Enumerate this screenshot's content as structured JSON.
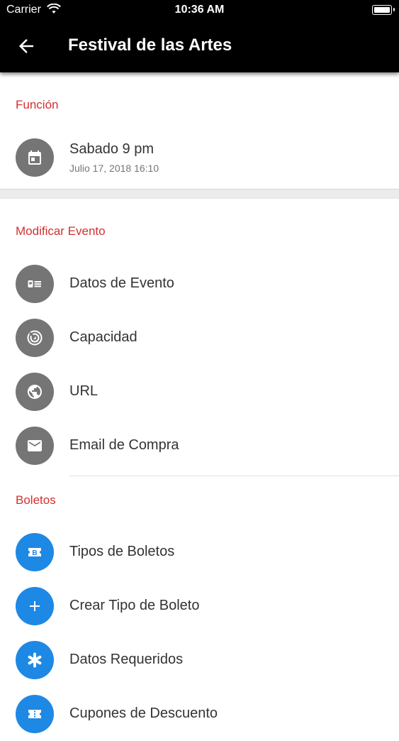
{
  "status_bar": {
    "carrier": "Carrier",
    "time": "10:36 AM"
  },
  "app_bar": {
    "title": "Festival de las Artes"
  },
  "funcion": {
    "section_title": "Función",
    "primary": "Sabado 9 pm",
    "secondary": "Julio 17, 2018 16:10",
    "icon": "calendar-icon"
  },
  "modificar": {
    "section_title": "Modificar Evento",
    "items": [
      {
        "label": "Datos de Evento",
        "icon": "event-card-icon"
      },
      {
        "label": "Capacidad",
        "icon": "capacity-icon"
      },
      {
        "label": "URL",
        "icon": "globe-icon"
      },
      {
        "label": "Email de Compra",
        "icon": "email-icon"
      }
    ]
  },
  "boletos": {
    "section_title": "Boletos",
    "items": [
      {
        "label": "Tipos de Boletos",
        "icon": "ticket-b-icon"
      },
      {
        "label": "Crear Tipo de Boleto",
        "icon": "plus-icon"
      },
      {
        "label": "Datos Requeridos",
        "icon": "asterisk-icon"
      },
      {
        "label": "Cupones de Descuento",
        "icon": "coupon-icon"
      }
    ]
  },
  "colors": {
    "accent": "#d32f2f",
    "grey_icon": "#757575",
    "blue_icon": "#1e88e5",
    "app_bar": "#000000"
  }
}
